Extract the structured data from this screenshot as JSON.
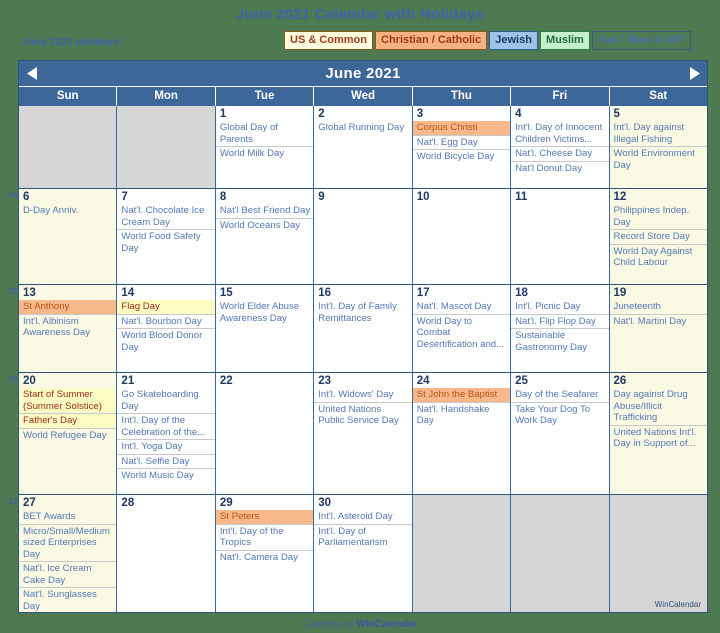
{
  "page": {
    "title": "June 2021 Calendar with Holidays",
    "holidays_label": "June 2021 Holidays:",
    "footer_prefix": "Courtesy of ",
    "footer_brand": "WinCalendar",
    "watermark": "WinCalendar",
    "background_color": "#4d7a51",
    "title_color": "#3f63ad"
  },
  "legend": {
    "items": [
      {
        "label": "US & Common",
        "bg": "#fbfbdd",
        "text": "#a03c1e"
      },
      {
        "label": "Christian / Catholic",
        "bg": "#f6b183",
        "text": "#9c3a14"
      },
      {
        "label": "Jewish",
        "bg": "#9dc3e6",
        "text": "#1f3864"
      },
      {
        "label": "Muslim",
        "bg": "#c6efce",
        "text": "#1f6b3c"
      },
      {
        "label": "Fun / Misc & Int'l",
        "bg": "transparent",
        "text": "#4a6fb5"
      }
    ]
  },
  "calendar": {
    "month_title": "June 2021",
    "prev_icon": "left-triangle-icon",
    "next_icon": "right-triangle-icon",
    "day_headers": [
      "Sun",
      "Mon",
      "Tue",
      "Wed",
      "Thu",
      "Fri",
      "Sat"
    ],
    "header_bg": "#3d6699",
    "weekend_bg": "#fafae4",
    "blank_bg": "#d6d6d6",
    "weeks": [
      {
        "week_number": "",
        "days": [
          {
            "num": "",
            "blank": true,
            "weekend": true,
            "events": []
          },
          {
            "num": "",
            "blank": true,
            "weekend": false,
            "events": []
          },
          {
            "num": "1",
            "weekend": false,
            "events": [
              {
                "label": "Global Day of Parents",
                "type": "fun"
              },
              {
                "label": "World Milk Day",
                "type": "fun"
              }
            ]
          },
          {
            "num": "2",
            "weekend": false,
            "events": [
              {
                "label": "Global Running Day",
                "type": "fun"
              }
            ]
          },
          {
            "num": "3",
            "weekend": false,
            "events": [
              {
                "label": "Corpus Christi",
                "type": "christian"
              },
              {
                "label": "Nat'l. Egg Day",
                "type": "fun"
              },
              {
                "label": "World Bicycle Day",
                "type": "fun"
              }
            ]
          },
          {
            "num": "4",
            "weekend": false,
            "events": [
              {
                "label": "Int'l. Day of Innocent Children Victims...",
                "type": "fun"
              },
              {
                "label": "Nat'l. Cheese Day",
                "type": "fun"
              },
              {
                "label": "Nat'l Donut Day",
                "type": "fun"
              }
            ]
          },
          {
            "num": "5",
            "weekend": true,
            "events": [
              {
                "label": "Int'l. Day against Illegal Fishing",
                "type": "fun"
              },
              {
                "label": "World Environment Day",
                "type": "fun"
              }
            ]
          }
        ]
      },
      {
        "week_number": "24",
        "days": [
          {
            "num": "6",
            "weekend": true,
            "events": [
              {
                "label": "D-Day Anniv.",
                "type": "fun"
              }
            ]
          },
          {
            "num": "7",
            "weekend": false,
            "events": [
              {
                "label": "Nat'l. Chocolate Ice Cream Day",
                "type": "fun"
              },
              {
                "label": "World Food Safety Day",
                "type": "fun"
              }
            ]
          },
          {
            "num": "8",
            "weekend": false,
            "events": [
              {
                "label": "Nat'l Best Friend Day",
                "type": "fun"
              },
              {
                "label": "World Oceans Day",
                "type": "fun"
              }
            ]
          },
          {
            "num": "9",
            "weekend": false,
            "events": []
          },
          {
            "num": "10",
            "weekend": false,
            "events": []
          },
          {
            "num": "11",
            "weekend": false,
            "events": []
          },
          {
            "num": "12",
            "weekend": true,
            "events": [
              {
                "label": "Philippines Indep. Day",
                "type": "fun"
              },
              {
                "label": "Record Store Day",
                "type": "fun"
              },
              {
                "label": "World Day Against Child Labour",
                "type": "fun"
              }
            ]
          }
        ]
      },
      {
        "week_number": "25",
        "days": [
          {
            "num": "13",
            "weekend": true,
            "events": [
              {
                "label": "St Anthony",
                "type": "christian"
              },
              {
                "label": "Int'l. Albinism Awareness Day",
                "type": "fun"
              }
            ]
          },
          {
            "num": "14",
            "weekend": false,
            "events": [
              {
                "label": "Flag Day",
                "type": "us"
              },
              {
                "label": "Nat'l. Bourbon Day",
                "type": "fun"
              },
              {
                "label": "World Blood Donor Day",
                "type": "fun"
              }
            ]
          },
          {
            "num": "15",
            "weekend": false,
            "events": [
              {
                "label": "World Elder Abuse Awareness Day",
                "type": "fun"
              }
            ]
          },
          {
            "num": "16",
            "weekend": false,
            "events": [
              {
                "label": "Int'l. Day of Family Remittances",
                "type": "fun"
              }
            ]
          },
          {
            "num": "17",
            "weekend": false,
            "events": [
              {
                "label": "Nat'l. Mascot Day",
                "type": "fun"
              },
              {
                "label": "World Day to Combat Desertification and...",
                "type": "fun"
              }
            ]
          },
          {
            "num": "18",
            "weekend": false,
            "events": [
              {
                "label": "Int'l. Picnic Day",
                "type": "fun"
              },
              {
                "label": "Nat'l. Flip Flop Day",
                "type": "fun"
              },
              {
                "label": "Sustainable Gastronomy Day",
                "type": "fun"
              }
            ]
          },
          {
            "num": "19",
            "weekend": true,
            "events": [
              {
                "label": "Juneteenth",
                "type": "fun"
              },
              {
                "label": "Nat'l. Martini Day",
                "type": "fun"
              }
            ]
          }
        ]
      },
      {
        "week_number": "26",
        "days": [
          {
            "num": "20",
            "weekend": true,
            "events": [
              {
                "label": "Start of Summer (Summer Solstice)",
                "type": "us"
              },
              {
                "label": "Father's Day",
                "type": "us"
              },
              {
                "label": "World Refugee Day",
                "type": "fun"
              }
            ]
          },
          {
            "num": "21",
            "weekend": false,
            "events": [
              {
                "label": "Go Skateboarding Day",
                "type": "fun"
              },
              {
                "label": "Int'l. Day of the Celebration of the...",
                "type": "fun"
              },
              {
                "label": "Int'l. Yoga Day",
                "type": "fun"
              },
              {
                "label": "Nat'l. Selfie Day",
                "type": "fun"
              },
              {
                "label": "World Music Day",
                "type": "fun"
              }
            ]
          },
          {
            "num": "22",
            "weekend": false,
            "events": []
          },
          {
            "num": "23",
            "weekend": false,
            "events": [
              {
                "label": "Int'l. Widows' Day",
                "type": "fun"
              },
              {
                "label": "United Nations Public Service Day",
                "type": "fun"
              }
            ]
          },
          {
            "num": "24",
            "weekend": false,
            "events": [
              {
                "label": "St John the Baptist",
                "type": "christian"
              },
              {
                "label": "Nat'l. Handshake Day",
                "type": "fun"
              }
            ]
          },
          {
            "num": "25",
            "weekend": false,
            "events": [
              {
                "label": "Day of the Seafarer",
                "type": "fun"
              },
              {
                "label": "Take Your Dog To Work Day",
                "type": "fun"
              }
            ]
          },
          {
            "num": "26",
            "weekend": true,
            "events": [
              {
                "label": "Day against Drug Abuse/Illicit Trafficking",
                "type": "fun"
              },
              {
                "label": "United Nations Int'l. Day in Support of...",
                "type": "fun"
              }
            ]
          }
        ]
      },
      {
        "week_number": "27",
        "days": [
          {
            "num": "27",
            "weekend": true,
            "events": [
              {
                "label": "BET Awards",
                "type": "fun"
              },
              {
                "label": "Micro/Small/Medium sized Enterprises Day",
                "type": "fun"
              },
              {
                "label": "Nat'l. Ice Cream Cake Day",
                "type": "fun"
              },
              {
                "label": "Nat'l. Sunglasses Day",
                "type": "fun"
              }
            ]
          },
          {
            "num": "28",
            "weekend": false,
            "events": []
          },
          {
            "num": "29",
            "weekend": false,
            "events": [
              {
                "label": "St Peters",
                "type": "christian"
              },
              {
                "label": "Int'l. Day of the Tropics",
                "type": "fun"
              },
              {
                "label": "Nat'l. Camera Day",
                "type": "fun"
              }
            ]
          },
          {
            "num": "30",
            "weekend": false,
            "events": [
              {
                "label": "Int'l. Asteroid Day",
                "type": "fun"
              },
              {
                "label": "Int'l. Day of Parliamentarism",
                "type": "fun"
              }
            ]
          },
          {
            "num": "",
            "blank": true,
            "weekend": false,
            "events": []
          },
          {
            "num": "",
            "blank": true,
            "weekend": false,
            "events": []
          },
          {
            "num": "",
            "blank": true,
            "weekend": true,
            "events": []
          }
        ]
      }
    ]
  }
}
